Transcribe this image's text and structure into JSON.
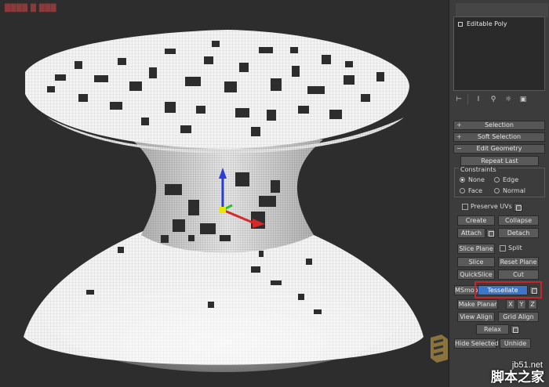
{
  "viewport": {
    "label": "████ █ ███",
    "colors": {
      "background": "#2d2d2d",
      "mesh": "#f2f2f2",
      "gizmo_z": "#2a3fd6",
      "gizmo_x": "#d62a2a",
      "gizmo_y": "#2ac22a"
    }
  },
  "stack": {
    "item": "Editable Poly"
  },
  "stack_tools": [
    "pin-stack-icon",
    "show-end-result-icon",
    "make-unique-icon",
    "remove-modifier-icon",
    "configure-sets-icon"
  ],
  "rollouts": {
    "selection": "Selection",
    "soft_selection": "Soft Selection",
    "edit_geometry": "Edit Geometry"
  },
  "edit_geometry": {
    "repeat_last": "Repeat Last",
    "constraints": "Constraints",
    "none": "None",
    "edge": "Edge",
    "face": "Face",
    "normal": "Normal",
    "preserve_uvs": "Preserve UVs",
    "create": "Create",
    "collapse": "Collapse",
    "attach": "Attach",
    "detach": "Detach",
    "slice_plane": "Slice Plane",
    "split": "Split",
    "slice": "Slice",
    "reset_plane": "Reset Plane",
    "quickslice": "QuickSlice",
    "cut": "Cut",
    "msmooth": "MSmooth",
    "tessellate": "Tessellate",
    "make_planar": "Make Planar",
    "x": "X",
    "y": "Y",
    "z": "Z",
    "view_align": "View Align",
    "grid_align": "Grid Align",
    "relax": "Relax",
    "hide_selected": "Hide Selected",
    "unhide": "Unhide"
  },
  "accent": {
    "highlight": "#c4262e",
    "active_button": "#3b76c9"
  },
  "watermark": {
    "site": "jb51.net",
    "cn": "脚本之家"
  }
}
